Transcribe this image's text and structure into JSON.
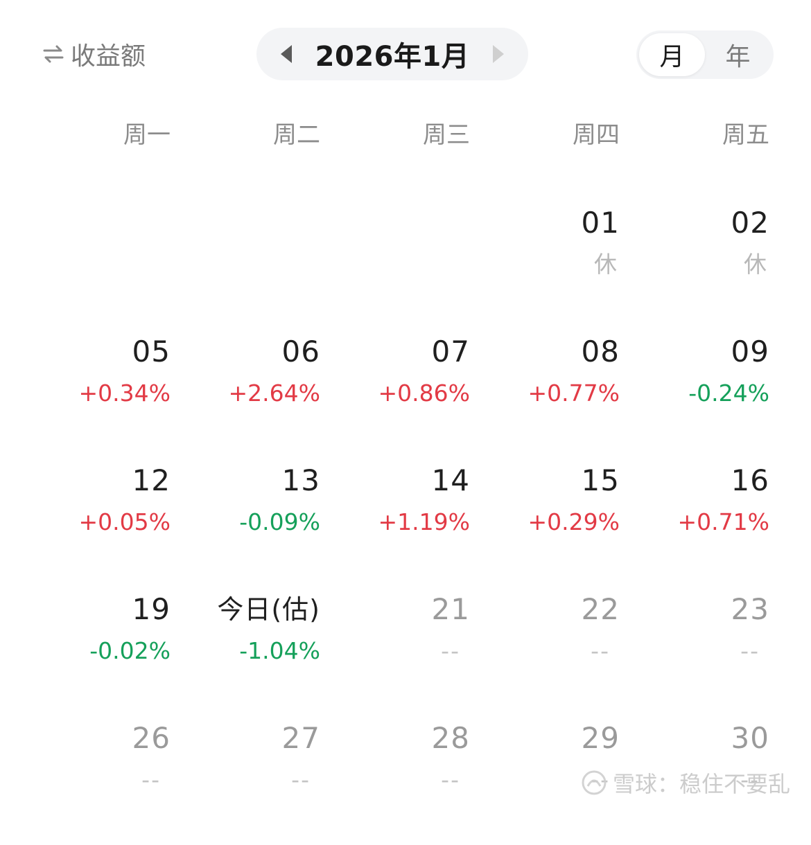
{
  "header": {
    "mode_label": "收益额",
    "month_label": "2026年1月",
    "period_options": [
      "月",
      "年"
    ],
    "active_period": "月"
  },
  "weekdays": [
    "周一",
    "周二",
    "周三",
    "周四",
    "周五"
  ],
  "colors": {
    "up": "#e23a45",
    "down": "#15a05a",
    "muted": "#9a9a9a"
  },
  "days": [
    {
      "day": "",
      "value": "",
      "state": "empty"
    },
    {
      "day": "",
      "value": "",
      "state": "empty"
    },
    {
      "day": "",
      "value": "",
      "state": "empty"
    },
    {
      "day": "01",
      "value": "休",
      "state": "holiday"
    },
    {
      "day": "02",
      "value": "休",
      "state": "holiday"
    },
    {
      "day": "05",
      "value": "+0.34%",
      "state": "up"
    },
    {
      "day": "06",
      "value": "+2.64%",
      "state": "up"
    },
    {
      "day": "07",
      "value": "+0.86%",
      "state": "up"
    },
    {
      "day": "08",
      "value": "+0.77%",
      "state": "up"
    },
    {
      "day": "09",
      "value": "-0.24%",
      "state": "down"
    },
    {
      "day": "12",
      "value": "+0.05%",
      "state": "up"
    },
    {
      "day": "13",
      "value": "-0.09%",
      "state": "down"
    },
    {
      "day": "14",
      "value": "+1.19%",
      "state": "up"
    },
    {
      "day": "15",
      "value": "+0.29%",
      "state": "up"
    },
    {
      "day": "16",
      "value": "+0.71%",
      "state": "up"
    },
    {
      "day": "19",
      "value": "-0.02%",
      "state": "down"
    },
    {
      "day": "今日(估)",
      "value": "-1.04%",
      "state": "down",
      "today": true
    },
    {
      "day": "21",
      "value": "--",
      "state": "future"
    },
    {
      "day": "22",
      "value": "--",
      "state": "future"
    },
    {
      "day": "23",
      "value": "--",
      "state": "future"
    },
    {
      "day": "26",
      "value": "--",
      "state": "future"
    },
    {
      "day": "27",
      "value": "--",
      "state": "future"
    },
    {
      "day": "28",
      "value": "--",
      "state": "future"
    },
    {
      "day": "29",
      "value": "--",
      "state": "future"
    },
    {
      "day": "30",
      "value": "--",
      "state": "future"
    }
  ],
  "watermark": "雪球：稳住不要乱"
}
